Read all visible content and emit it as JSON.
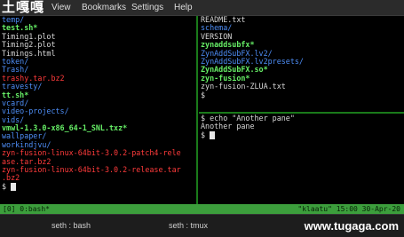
{
  "logo_text": "土嘎嘎",
  "menu": [
    "View",
    "Bookmarks",
    "Settings",
    "Help"
  ],
  "left_pane": [
    {
      "text": "temp/",
      "cls": "c-dir"
    },
    {
      "text": "test.sh*",
      "cls": "c-exe"
    },
    {
      "text": "Timing1.plot",
      "cls": "c-txt"
    },
    {
      "text": "Timing2.plot",
      "cls": "c-txt"
    },
    {
      "text": "Timings.html",
      "cls": "c-txt"
    },
    {
      "text": "token/",
      "cls": "c-dir"
    },
    {
      "text": "Trash/",
      "cls": "c-dir"
    },
    {
      "text": "trashy.tar.bz2",
      "cls": "c-arc"
    },
    {
      "text": "travesty/",
      "cls": "c-dir"
    },
    {
      "text": "tt.sh*",
      "cls": "c-exe"
    },
    {
      "text": "vcard/",
      "cls": "c-dir"
    },
    {
      "text": "video-projects/",
      "cls": "c-dir"
    },
    {
      "text": "vids/",
      "cls": "c-dir"
    },
    {
      "text": "vmwl-1.3.0-x86_64-1_SNL.txz*",
      "cls": "c-exe"
    },
    {
      "text": "wallpaper/",
      "cls": "c-dir"
    },
    {
      "text": "workindjvu/",
      "cls": "c-dir"
    },
    {
      "text": "zyn-fusion-linux-64bit-3.0.2-patch4-rele",
      "cls": "c-arc"
    },
    {
      "text": "ase.tar.bz2",
      "cls": "c-arc"
    },
    {
      "text": "zyn-fusion-linux-64bit-3.0.2-release.tar",
      "cls": "c-arc"
    },
    {
      "text": ".bz2",
      "cls": "c-arc"
    },
    {
      "text": "$ ",
      "cls": "c-txt",
      "cursor": true
    }
  ],
  "right_top_pane": [
    {
      "text": "README.txt",
      "cls": "c-txt"
    },
    {
      "text": "schema/",
      "cls": "c-dir"
    },
    {
      "text": "VERSION",
      "cls": "c-txt"
    },
    {
      "text": "zynaddsubfx*",
      "cls": "c-exe"
    },
    {
      "text": "ZynAddSubFX.lv2/",
      "cls": "c-dir"
    },
    {
      "text": "ZynAddSubFX.lv2presets/",
      "cls": "c-dir"
    },
    {
      "text": "ZynAddSubFX.so*",
      "cls": "c-exe"
    },
    {
      "text": "zyn-fusion*",
      "cls": "c-exe"
    },
    {
      "text": "zyn-fusion-ZLUA.txt",
      "cls": "c-txt"
    },
    {
      "text": "$ ",
      "cls": "c-txt",
      "cursor": false
    }
  ],
  "right_bot_pane": [
    {
      "text": "$ echo \"Another pane\"",
      "cls": "c-txt"
    },
    {
      "text": "Another pane",
      "cls": "c-txt"
    },
    {
      "text": "$ ",
      "cls": "c-txt",
      "cursor": true
    }
  ],
  "status_left": "[0] 0:bash*",
  "status_right": "\"klaatu\" 15:00 30-Apr-20",
  "tabs": [
    "seth : bash",
    "seth : tmux"
  ],
  "watermark": "www.tugaga.com"
}
